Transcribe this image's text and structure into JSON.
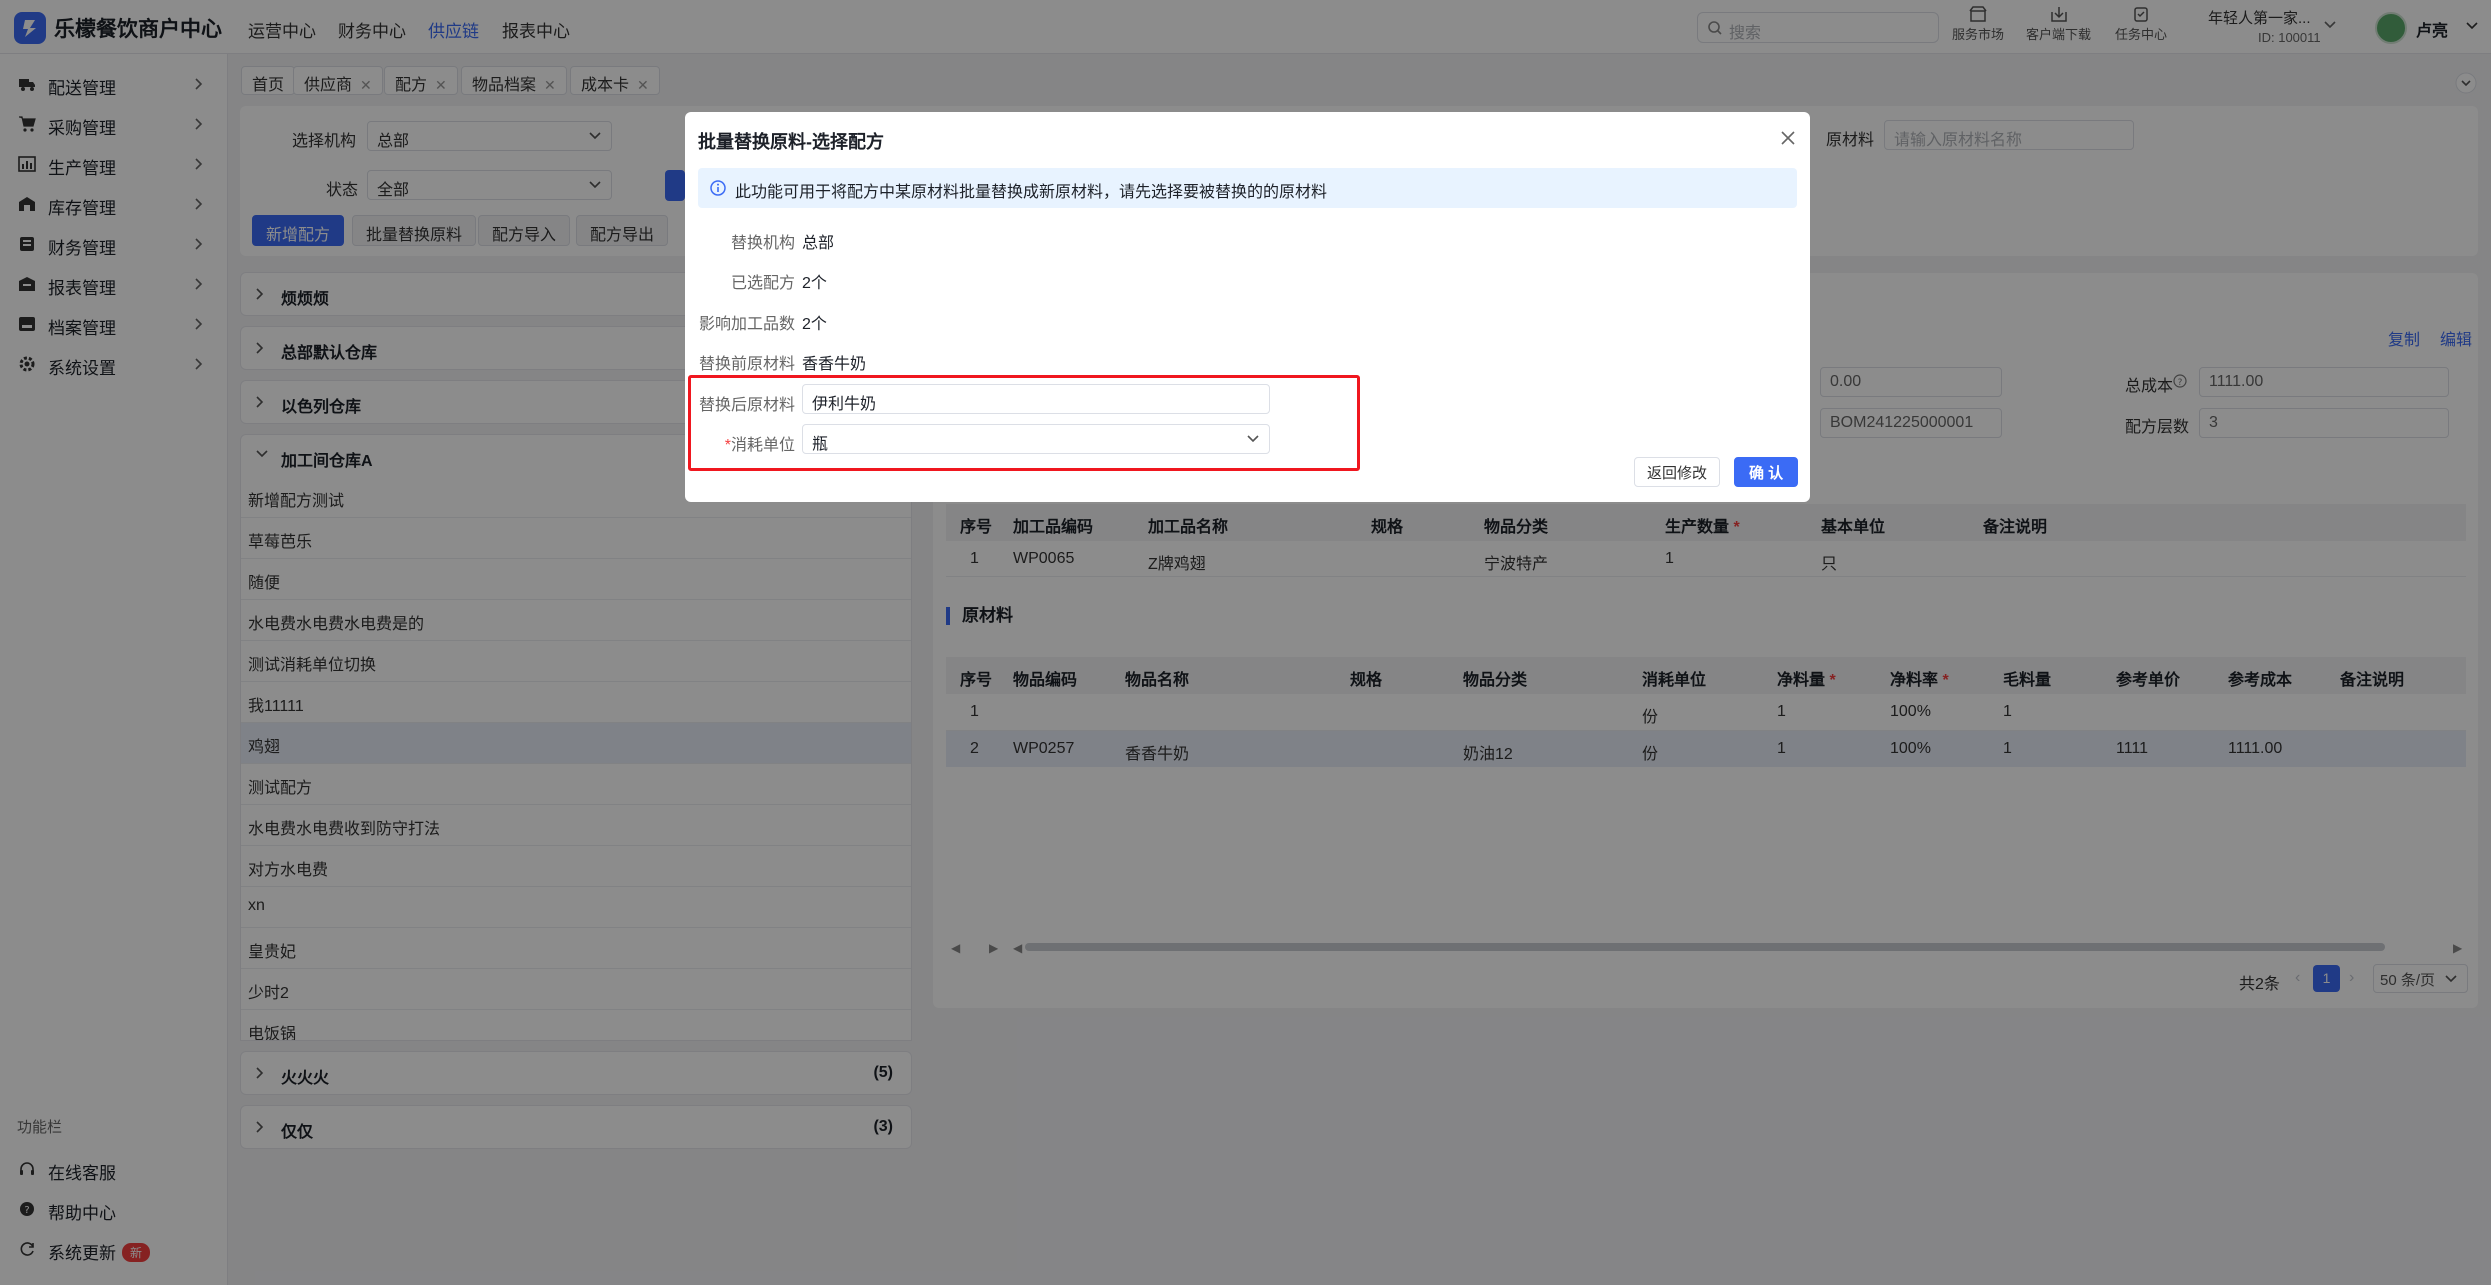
{
  "app": {
    "title": "乐檬餐饮商户中心"
  },
  "topnav": [
    "运营中心",
    "财务中心",
    "供应链",
    "报表中心"
  ],
  "search": {
    "placeholder": "搜索"
  },
  "tools": [
    {
      "label": "服务市场",
      "icon": "store-icon"
    },
    {
      "label": "客户端下载",
      "icon": "download-icon"
    },
    {
      "label": "任务中心",
      "icon": "task-icon"
    }
  ],
  "org": {
    "name": "年轻人第一家...",
    "id": "ID: 100011"
  },
  "user": {
    "name": "卢亮"
  },
  "sidebar": {
    "items": [
      {
        "label": "配送管理",
        "icon": "truck-icon"
      },
      {
        "label": "采购管理",
        "icon": "cart-icon"
      },
      {
        "label": "生产管理",
        "icon": "chart-icon"
      },
      {
        "label": "库存管理",
        "icon": "warehouse-icon"
      },
      {
        "label": "财务管理",
        "icon": "ledger-icon"
      },
      {
        "label": "报表管理",
        "icon": "report-icon"
      },
      {
        "label": "档案管理",
        "icon": "archive-icon"
      },
      {
        "label": "系统设置",
        "icon": "gear-icon"
      }
    ],
    "section_title": "功能栏",
    "bottom": [
      {
        "label": "在线客服",
        "icon": "headset-icon"
      },
      {
        "label": "帮助中心",
        "icon": "help-icon"
      },
      {
        "label": "系统更新",
        "icon": "refresh-icon",
        "badge": "新"
      }
    ]
  },
  "tabs": [
    {
      "label": "首页",
      "closable": false
    },
    {
      "label": "供应商",
      "closable": true
    },
    {
      "label": "配方",
      "closable": true
    },
    {
      "label": "物品档案",
      "closable": true
    },
    {
      "label": "成本卡",
      "closable": true
    }
  ],
  "filters": {
    "org_label": "选择机构",
    "org_value": "总部",
    "status_label": "状态",
    "status_value": "全部",
    "material_label": "原材料",
    "material_placeholder": "请输入原材料名称"
  },
  "actions": [
    "新增配方",
    "批量替换原料",
    "配方导入",
    "配方导出"
  ],
  "groups": [
    {
      "name": "烦烦烦",
      "count": ""
    },
    {
      "name": "总部默认仓库",
      "count": ""
    },
    {
      "name": "以色列仓库",
      "count": ""
    },
    {
      "name": "加工间仓库A",
      "count": ""
    },
    {
      "name": "火火火",
      "count": "(5)"
    },
    {
      "name": "仅仅",
      "count": "(3)"
    }
  ],
  "recipe_list": [
    "新增配方测试",
    "草莓芭乐",
    "随便",
    "水电费水电费水电费是的",
    "测试消耗单位切换",
    "我11111",
    "鸡翅",
    "测试配方",
    "水电费水电费收到防守打法",
    "对方水电费",
    "xn",
    "皇贵妃",
    "少时2",
    "电饭锅"
  ],
  "detail": {
    "copy": "复制",
    "edit": "编辑",
    "field_a_value": "0.00",
    "total_cost_label": "总成本",
    "total_cost_value": "1111.00",
    "bom_value": "BOM241225000001",
    "layers_label": "配方层数",
    "layers_value": "3",
    "product_headers": [
      "序号",
      "加工品编码",
      "加工品名称",
      "规格",
      "物品分类",
      "生产数量",
      "基本单位",
      "备注说明"
    ],
    "product_rows": [
      [
        "1",
        "WP0065",
        "Z牌鸡翅",
        "",
        "宁波特产",
        "1",
        "只",
        ""
      ]
    ],
    "raw_title": "原材料",
    "raw_headers": [
      "序号",
      "物品编码",
      "物品名称",
      "规格",
      "物品分类",
      "消耗单位",
      "净料量",
      "净料率",
      "毛料量",
      "参考单价",
      "参考成本",
      "备注说明"
    ],
    "raw_rows": [
      [
        "1",
        "",
        "",
        "",
        "",
        "份",
        "1",
        "100%",
        "1",
        "",
        "",
        ""
      ],
      [
        "2",
        "WP0257",
        "香香牛奶",
        "",
        "奶油12",
        "份",
        "1",
        "100%",
        "1",
        "1111",
        "1111.00",
        ""
      ]
    ],
    "pagination": {
      "total": "共2条",
      "page": "1",
      "page_size": "50 条/页"
    }
  },
  "modal": {
    "title": "批量替换原料-选择配方",
    "info": "此功能可用于将配方中某原材料批量替换成新原材料，请先选择要被替换的的原材料",
    "rows": [
      {
        "label": "替换机构",
        "value": "总部"
      },
      {
        "label": "已选配方",
        "value": "2个"
      },
      {
        "label": "影响加工品数",
        "value": "2个"
      },
      {
        "label": "替换前原材料",
        "value": "香香牛奶"
      }
    ],
    "after_label": "替换后原材料",
    "after_value": "伊利牛奶",
    "unit_label": "消耗单位",
    "unit_value": "瓶",
    "back_button": "返回修改",
    "confirm_button": "确 认"
  },
  "colors": {
    "primary": "#3b6bf5",
    "danger": "#f53f3f",
    "highlight_frame": "#f0171f"
  }
}
